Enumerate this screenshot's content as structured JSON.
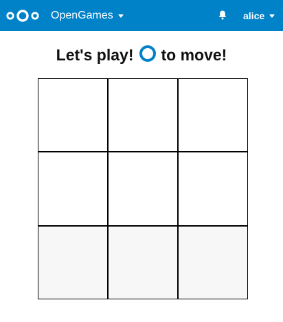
{
  "header": {
    "logo_icon": "nextcloud-logo-icon",
    "app_name": "OpenGames",
    "notifications_icon": "bell-icon",
    "user_name": "alice",
    "bg_color": "#0082c9"
  },
  "game": {
    "title_prefix": "Let's play!",
    "title_suffix": "to move!",
    "current_player_icon": "o-marker-icon",
    "accent_color": "#0082c9",
    "board": [
      [
        "",
        "",
        ""
      ],
      [
        "",
        "",
        ""
      ],
      [
        "",
        "",
        ""
      ]
    ]
  }
}
